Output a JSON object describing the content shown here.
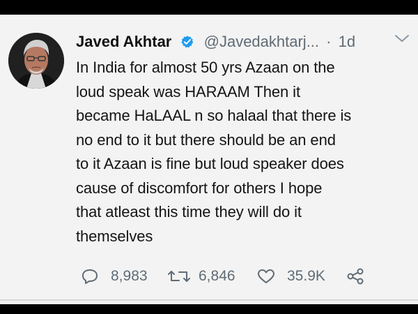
{
  "tweet": {
    "author_name": "Javed Akhtar",
    "handle": "@Javedakhtarj...",
    "separator": "·",
    "timestamp": "1d",
    "text_lines": [
      "In India for almost 50 yrs Azaan on the",
      "loud speak was HARAAM Then it",
      "became HaLAAL n so halaal that there is",
      "no end to it but there should be an end",
      "to it Azaan is fine but loud speaker does",
      "cause of discomfort for others I hope",
      "that atleast this time they will do it",
      "themselves"
    ],
    "replies": "8,983",
    "retweets": "6,846",
    "likes": "35.9K"
  },
  "icons": {
    "verified": "verified-badge-icon",
    "menu": "chevron-down-icon",
    "reply": "reply-icon",
    "retweet": "retweet-icon",
    "like": "heart-icon",
    "share": "share-icon"
  },
  "colors": {
    "background": "#f3f3f3",
    "border": "#000000",
    "verified": "#1d9bf0",
    "secondary_text": "#5f6b75",
    "primary_text": "#141414"
  }
}
